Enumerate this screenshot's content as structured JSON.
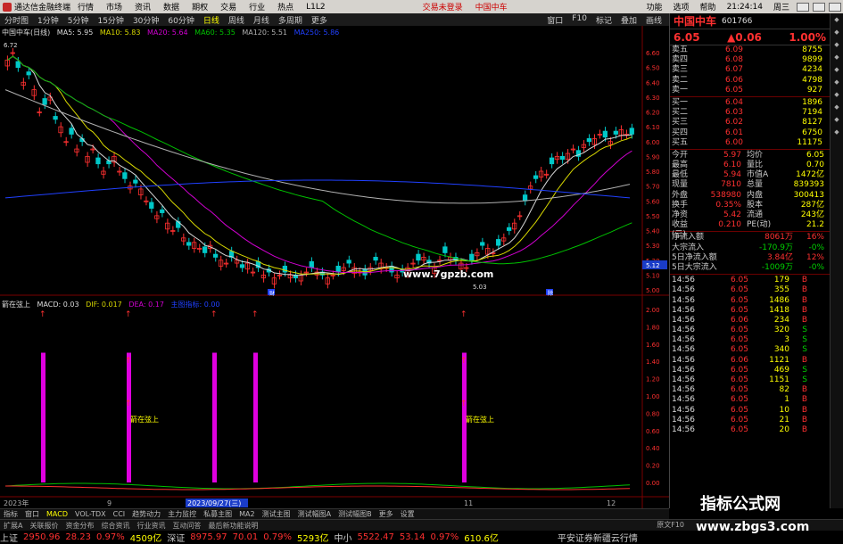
{
  "app": {
    "title": "通达信金融终端",
    "menu": [
      "行情",
      "市场",
      "资讯",
      "数据",
      "期权",
      "交易",
      "行业",
      "热点",
      "L1L2"
    ],
    "trade_status": "交易未登录",
    "stock_name_menu": "中国中车",
    "right_menu": [
      "功能",
      "选项",
      "帮助"
    ],
    "time": "21:24:14",
    "weekday": "周三"
  },
  "toolbar": {
    "periods": [
      "分时图",
      "1分钟",
      "5分钟",
      "15分钟",
      "30分钟",
      "60分钟",
      "日线",
      "周线",
      "月线",
      "多周期",
      "更多"
    ],
    "active_period": "日线",
    "right": [
      "窗口",
      "F10",
      "标记",
      "叠加",
      "画线",
      "返回"
    ]
  },
  "chart": {
    "header": {
      "title": "中国中车(日线)",
      "ma5": "MA5: 5.95",
      "ma10": "MA10: 5.83",
      "ma20": "MA20: 5.64",
      "ma60": "MA60: 5.35",
      "ma120": "MA120: 5.51",
      "ma250": "MA250: 5.86"
    },
    "price_axis": [
      "6.60",
      "6.50",
      "6.40",
      "6.30",
      "6.20",
      "6.10",
      "6.00",
      "5.90",
      "5.80",
      "5.70",
      "5.60",
      "5.50",
      "5.40",
      "5.30",
      "5.20",
      "5.10",
      "5.00"
    ],
    "current_price_tag": "5.12",
    "high_label": "6.72",
    "low_label": "5.03",
    "sub_header": {
      "name": "箭在弦上",
      "macd": "MACD: 0.03",
      "dif": "DIF: 0.017",
      "dea": "DEA: 0.17",
      "extra": "主图指标: 0.00"
    },
    "sub_axis": [
      "2.00",
      "1.80",
      "1.60",
      "1.40",
      "1.20",
      "1.00",
      "0.80",
      "0.60",
      "0.40",
      "0.20",
      "0.00"
    ],
    "signal_label": "箭在弦上",
    "date_labels": [
      "2023年",
      "9",
      "2023/09/27(三)",
      "11",
      "12"
    ],
    "event_markers": [
      "财",
      "除"
    ],
    "colors": {
      "up": "#ff3030",
      "down": "#00c8c8",
      "ma5": "#d8d8d8",
      "ma10": "#d8d800",
      "ma20": "#d000d0",
      "ma60": "#00c000",
      "ma120": "#b0b0b0",
      "ma250": "#2040ff",
      "signal_bar": "#e000e0"
    }
  },
  "quote": {
    "name": "中国中车",
    "code": "601766",
    "price": "6.05",
    "change": "▲0.06",
    "change_pct": "1.00%",
    "asks": [
      {
        "label": "卖五",
        "price": "6.09",
        "vol": "8755"
      },
      {
        "label": "卖四",
        "price": "6.08",
        "vol": "9899"
      },
      {
        "label": "卖三",
        "price": "6.07",
        "vol": "4234"
      },
      {
        "label": "卖二",
        "price": "6.06",
        "vol": "4798"
      },
      {
        "label": "卖一",
        "price": "6.05",
        "vol": "927"
      }
    ],
    "bids": [
      {
        "label": "买一",
        "price": "6.04",
        "vol": "1896"
      },
      {
        "label": "买二",
        "price": "6.03",
        "vol": "7194"
      },
      {
        "label": "买三",
        "price": "6.02",
        "vol": "8127"
      },
      {
        "label": "买四",
        "price": "6.01",
        "vol": "6750"
      },
      {
        "label": "买五",
        "price": "6.00",
        "vol": "11175"
      }
    ],
    "stats": [
      {
        "l": "今开",
        "v": "5.97",
        "l2": "均价",
        "v2": "6.05"
      },
      {
        "l": "最高",
        "v": "6.10",
        "l2": "量比",
        "v2": "0.70"
      },
      {
        "l": "最低",
        "v": "5.94",
        "l2": "市值A",
        "v2": "1472亿"
      },
      {
        "l": "现量",
        "v": "7810",
        "l2": "总量",
        "v2": "839393"
      },
      {
        "l": "外盘",
        "v": "538980",
        "l2": "内盘",
        "v2": "300413"
      },
      {
        "l": "换手",
        "v": "0.35%",
        "l2": "股本",
        "v2": "287亿"
      },
      {
        "l": "净资",
        "v": "5.42",
        "l2": "流通",
        "v2": "243亿"
      },
      {
        "l": "收益(三)",
        "v": "0.210",
        "l2": "PE(动)",
        "v2": "21.2"
      }
    ],
    "flows": [
      {
        "l": "净流入额",
        "v": "8061万",
        "p": "16%"
      },
      {
        "l": "大宗流入",
        "v": "-170.9万",
        "p": "-0%"
      },
      {
        "l": "5日净流入额",
        "v": "3.84亿",
        "p": "12%"
      },
      {
        "l": "5日大宗流入",
        "v": "-1009万",
        "p": "-0%"
      }
    ],
    "ticks": [
      {
        "t": "14:56",
        "p": "6.05",
        "v": "179",
        "bs": "B"
      },
      {
        "t": "14:56",
        "p": "6.05",
        "v": "355",
        "bs": "B"
      },
      {
        "t": "14:56",
        "p": "6.05",
        "v": "1486",
        "bs": "B"
      },
      {
        "t": "14:56",
        "p": "6.05",
        "v": "1418",
        "bs": "B"
      },
      {
        "t": "14:56",
        "p": "6.06",
        "v": "234",
        "bs": "B"
      },
      {
        "t": "14:56",
        "p": "6.05",
        "v": "320",
        "bs": "S"
      },
      {
        "t": "14:56",
        "p": "6.05",
        "v": "3",
        "bs": "S"
      },
      {
        "t": "14:56",
        "p": "6.05",
        "v": "340",
        "bs": "S"
      },
      {
        "t": "14:56",
        "p": "6.06",
        "v": "1121",
        "bs": "B"
      },
      {
        "t": "14:56",
        "p": "6.05",
        "v": "469",
        "bs": "S"
      },
      {
        "t": "14:56",
        "p": "6.05",
        "v": "1151",
        "bs": "S"
      },
      {
        "t": "14:56",
        "p": "6.05",
        "v": "82",
        "bs": "B"
      },
      {
        "t": "14:56",
        "p": "6.05",
        "v": "1",
        "bs": "B"
      },
      {
        "t": "14:56",
        "p": "6.05",
        "v": "10",
        "bs": "B"
      },
      {
        "t": "14:56",
        "p": "6.05",
        "v": "21",
        "bs": "B"
      },
      {
        "t": "14:56",
        "p": "6.05",
        "v": "20",
        "bs": "B"
      }
    ]
  },
  "bottom_tabs": [
    "指标",
    "窗口",
    "MACD",
    "VOL-TDX",
    "CCI",
    "趋势动力",
    "主力监控",
    "私募主图",
    "MA2",
    "测试主图",
    "测试幅图A",
    "测试幅图B",
    "更多",
    "设置"
  ],
  "bottom_tab_active": "MACD",
  "bottom_left_labels": [
    "扩展A",
    "关联报价",
    "资金分布",
    "综合资讯",
    "行业资讯",
    "互动问答",
    "最后新功能说明"
  ],
  "bottom_right_label": "原文F10",
  "status": {
    "sh_label": "上证",
    "sh_value": "2950.96",
    "sh_chg": "28.23",
    "sh_pct": "0.97%",
    "sh_amt": "4509亿",
    "sz_label": "深证",
    "sz_value": "8975.97",
    "sz_chg": "70.01",
    "sz_pct": "0.79%",
    "sz_amt": "5293亿",
    "zx_label": "中小",
    "zx_value": "5522.47",
    "zx_chg": "53.14",
    "zx_pct": "0.97%",
    "zx_amt": "610.6亿",
    "broker": "平安证券新疆云行情"
  },
  "watermarks": {
    "site1": "www.7gpzb.com",
    "brand": "指标公式网",
    "site2": "www.zbgs3.com"
  }
}
